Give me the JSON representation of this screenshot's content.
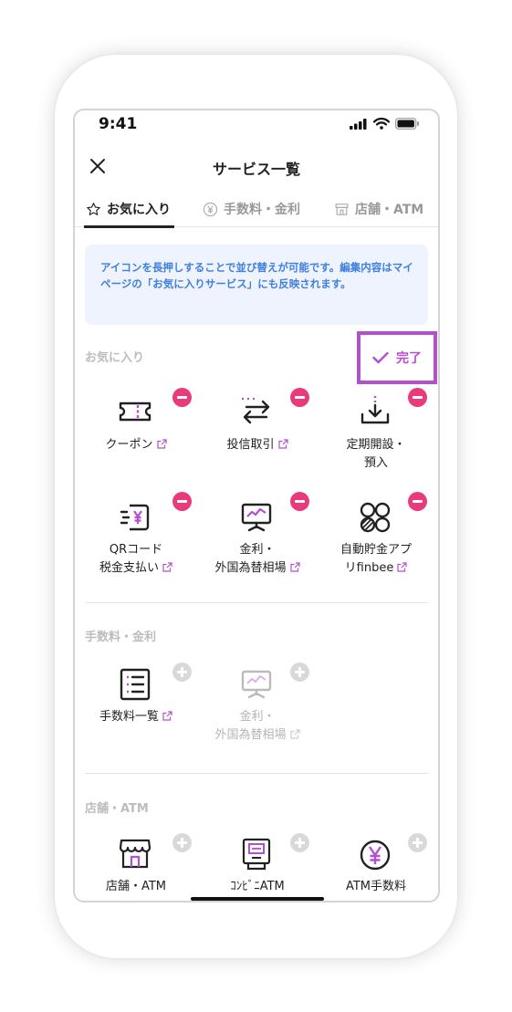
{
  "status": {
    "time": "9:41"
  },
  "header": {
    "title": "サービス一覧"
  },
  "tabs": [
    {
      "label": "お気に入り",
      "icon": "star-icon"
    },
    {
      "label": "手数料・金利",
      "icon": "yen-circle-icon"
    },
    {
      "label": "店舗・ATM",
      "icon": "store-icon"
    }
  ],
  "info": {
    "text": "アイコンを長押しすることで並び替えが可能です。編集内容はマイページの「お気に入りサービス」にも反映されます。"
  },
  "favorites": {
    "title": "お気に入り",
    "done_label": "完了",
    "items": [
      {
        "label": "クーポン",
        "icon": "coupon-icon"
      },
      {
        "label": "投信取引",
        "icon": "exchange-arrows-icon"
      },
      {
        "label_line1": "定期開設・",
        "label_line2": "預入",
        "icon": "deposit-download-icon"
      },
      {
        "label_line1": "QRコード",
        "label_line2": "税金支払い",
        "icon": "qr-tax-icon"
      },
      {
        "label_line1": "金利・",
        "label_line2": "外国為替相場",
        "icon": "rate-monitor-icon"
      },
      {
        "label_line1": "自動貯金アプ",
        "label_line2": "リfinbee",
        "icon": "finbee-icon"
      }
    ]
  },
  "fees": {
    "title": "手数料・金利",
    "items": [
      {
        "label": "手数料一覧",
        "icon": "fee-list-icon"
      },
      {
        "label_line1": "金利・",
        "label_line2": "外国為替相場",
        "icon": "rate-monitor-icon"
      }
    ]
  },
  "stores": {
    "title": "店舗・ATM",
    "items": [
      {
        "label": "店舗・ATM",
        "icon": "store-icon"
      },
      {
        "label": "ｺﾝﾋﾞﾆATM",
        "icon": "atm-machine-icon"
      },
      {
        "label": "ATM手数料",
        "icon": "yen-circle-icon"
      }
    ]
  },
  "colors": {
    "accent": "#b44fd0",
    "remove": "#e93a7c",
    "info_text": "#3f7fe0",
    "info_bg": "#eef3fd"
  }
}
